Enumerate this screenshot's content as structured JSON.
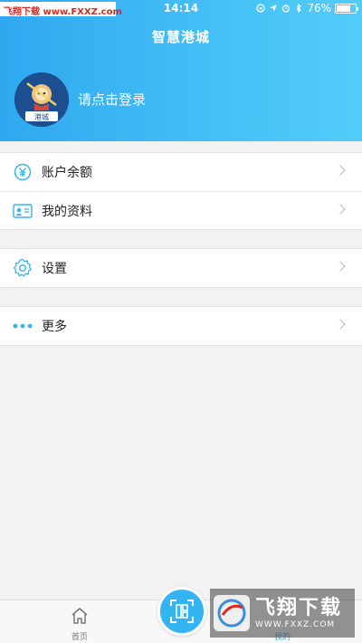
{
  "status_bar": {
    "watermark": "飞翔下载 www.FXXZ.com",
    "time": "14:14",
    "battery_percent": "76%",
    "battery_level": 0.76
  },
  "header": {
    "title": "智慧港城",
    "login_prompt": "请点击登录",
    "avatar_label": "港城"
  },
  "menu_groups": [
    [
      {
        "label": "账户余额",
        "icon": "yuan-icon"
      },
      {
        "label": "我的资料",
        "icon": "id-card-icon"
      }
    ],
    [
      {
        "label": "设置",
        "icon": "gear-icon"
      }
    ],
    [
      {
        "label": "更多",
        "icon": "more-dots-icon"
      }
    ]
  ],
  "tabbar": {
    "home_label": "首页",
    "mine_label": "我的"
  },
  "watermark_bottom": {
    "title": "飞翔下载",
    "url": "WWW.FXXZ.COM"
  },
  "colors": {
    "accent": "#35b4f2",
    "header_gradient_start": "#2fa8ef",
    "header_gradient_end": "#52cdf8"
  }
}
